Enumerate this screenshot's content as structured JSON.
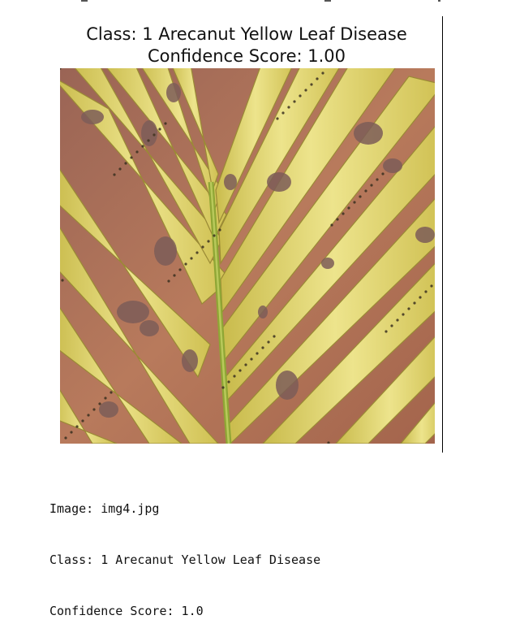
{
  "figure": {
    "title_line_1": "Class: 1 Arecanut Yellow Leaf Disease",
    "title_line_2": "Confidence Score: 1.00"
  },
  "image": {
    "alt": "Photo of arecanut leaf with yellow leaf disease",
    "colors": {
      "background": "#a86b55",
      "leaf": "#d9cc5a",
      "leaf_light": "#ece48a",
      "midrib": "#8fa635",
      "lesion": "#7a5a55"
    }
  },
  "output": {
    "image_line": "Image: img4.jpg",
    "class_line": "Class: 1 Arecanut Yellow Leaf Disease",
    "confidence_line": "Confidence Score: 1.0"
  }
}
